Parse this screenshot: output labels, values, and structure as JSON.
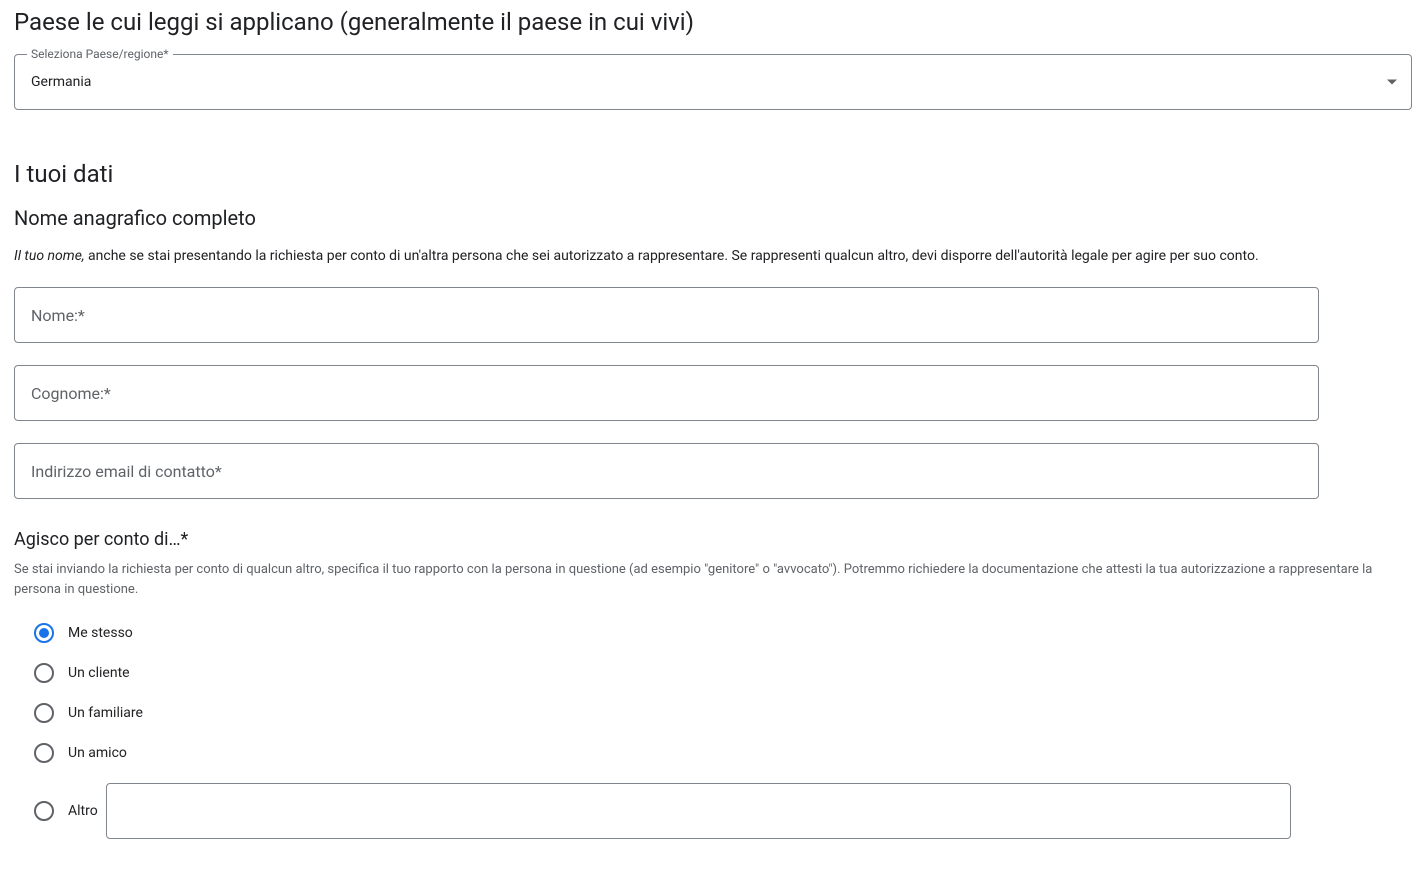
{
  "country": {
    "heading": "Paese le cui leggi si applicano (generalmente il paese in cui vivi)",
    "select_label": "Seleziona Paese/regione*",
    "selected_value": "Germania"
  },
  "your_data": {
    "heading": "I tuoi dati",
    "full_name_heading": "Nome anagrafico completo",
    "name_desc_italic": "Il tuo nome,",
    "name_desc_rest": " anche se stai presentando la richiesta per conto di un'altra persona che sei autorizzato a rappresentare. Se rappresenti qualcun altro, devi disporre dell'autorità legale per agire per suo conto.",
    "first_name_placeholder": "Nome:*",
    "last_name_placeholder": "Cognome:*",
    "email_placeholder": "Indirizzo email di contatto*"
  },
  "on_behalf": {
    "heading": "Agisco per conto di…*",
    "helptext": "Se stai inviando la richiesta per conto di qualcun altro, specifica il tuo rapporto con la persona in questione (ad esempio \"genitore\" o \"avvocato\"). Potremmo richiedere la documentazione che attesti la tua autorizzazione a rappresentare la persona in questione.",
    "options": {
      "myself": "Me stesso",
      "client": "Un cliente",
      "family": "Un familiare",
      "friend": "Un amico",
      "other": "Altro"
    }
  }
}
